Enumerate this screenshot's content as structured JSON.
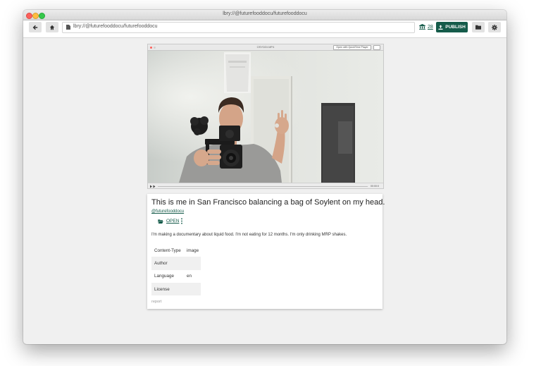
{
  "window": {
    "title": "lbry://@futurefooddocu/futurefooddocu"
  },
  "header": {
    "back_icon": "arrow-left-icon",
    "home_icon": "home-icon",
    "url": "lbry://@futurefooddocu/futurefooddocu",
    "balance": "28",
    "publish_label": "PUBLISH",
    "folder_icon": "folder-icon",
    "settings_icon": "gear-icon",
    "accent_color": "#155b4a"
  },
  "video": {
    "player_title": "OSYDDI.MP4",
    "open_with_label": "Open with QuickTime Player"
  },
  "claim": {
    "title": "This is me in San Francisco balancing a bag of Soylent on my head.",
    "channel": "@futurefooddocu",
    "open_label": "OPEN",
    "description": "I'm making a documentary about liquid food. I'm not eating for 12 months. I'm only drinking MRP shakes.",
    "metadata": [
      {
        "label": "Content-Type",
        "value": "image"
      },
      {
        "label": "Author",
        "value": ""
      },
      {
        "label": "Language",
        "value": "en"
      },
      {
        "label": "License",
        "value": ""
      }
    ],
    "report_label": "report"
  }
}
